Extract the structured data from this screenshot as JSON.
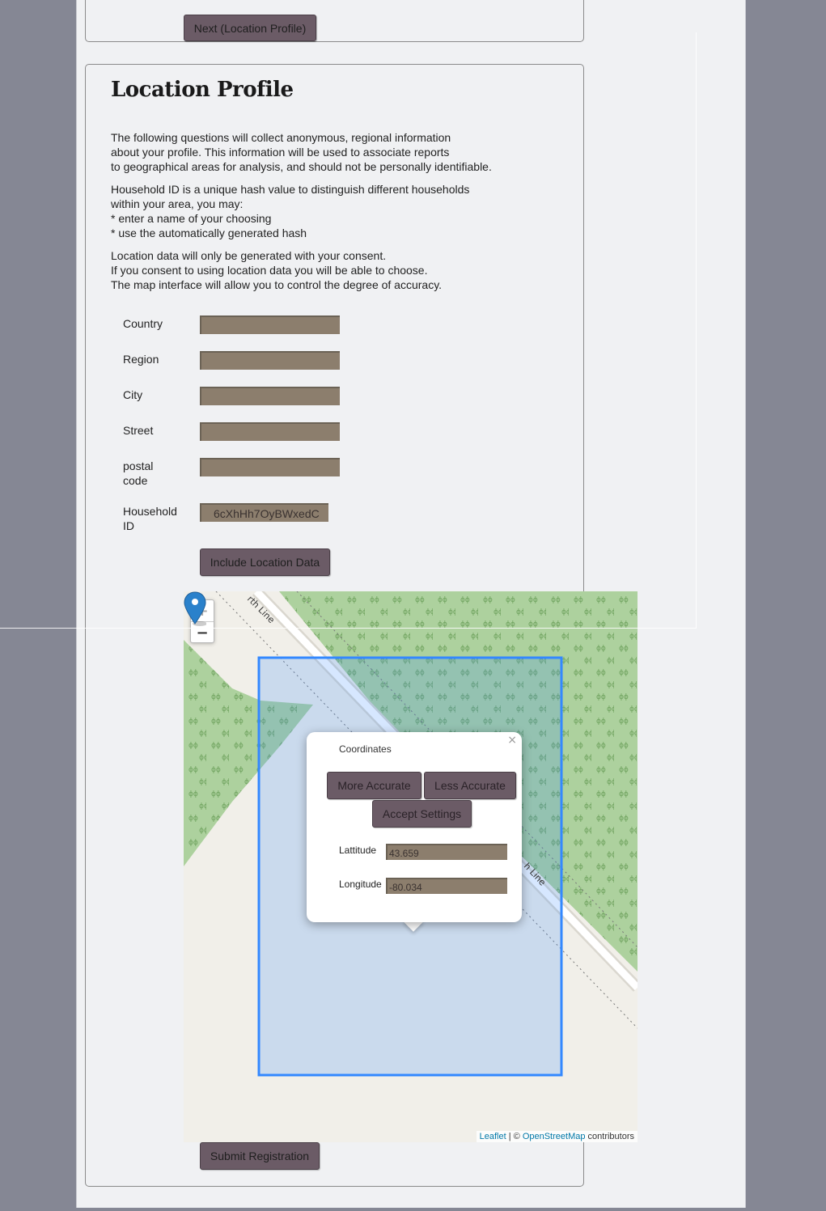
{
  "top_section": {
    "next_button": "Next (Location Profile)"
  },
  "location_profile": {
    "title": "Location Profile",
    "intro_lines": [
      "The following questions will collect anonymous, regional information",
      "about your profile. This information will be used to associate reports",
      "to geographical areas for analysis, and should not be personally identifiable."
    ],
    "household_lines": [
      "Household ID is a unique hash value to distinguish different households",
      "within your area, you may:",
      "* enter a name of your choosing",
      "* use the automatically generated hash"
    ],
    "consent_lines": [
      "Location data will only be generated with your consent.",
      "If you consent to using location data you will be able to choose.",
      "The map interface will allow you to control the degree of accuracy."
    ],
    "fields": {
      "country": {
        "label": "Country",
        "value": ""
      },
      "region": {
        "label": "Region",
        "value": ""
      },
      "city": {
        "label": "City",
        "value": ""
      },
      "street": {
        "label": "Street",
        "value": ""
      },
      "postal": {
        "label_line1": "postal",
        "label_line2": "code",
        "value": ""
      },
      "household": {
        "label_line1": "Household",
        "label_line2": "ID",
        "value": "6cXhHh7OyBWxedC"
      }
    },
    "include_location_button": "Include Location Data",
    "submit_button": "Submit Registration"
  },
  "map": {
    "zoom_in": "+",
    "zoom_out": "−",
    "road_label_top": "rth Line",
    "road_label_bottom": "h Line",
    "popup": {
      "title": "Coordinates",
      "close": "×",
      "more_accurate": "More Accurate",
      "less_accurate": "Less Accurate",
      "accept": "Accept Settings",
      "latitude_label": "Lattitude",
      "latitude_value": "43.659",
      "longitude_label": "Longitude",
      "longitude_value": "-80.034"
    },
    "attribution": {
      "leaflet": "Leaflet",
      "separator": " | © ",
      "osm": "OpenStreetMap",
      "suffix": " contributors"
    },
    "colors": {
      "forest": "#add19e",
      "land": "#f1efe9",
      "selection_fill": "#3388ff",
      "selection_stroke": "#3388ff",
      "marker": "#2a81cb"
    }
  }
}
